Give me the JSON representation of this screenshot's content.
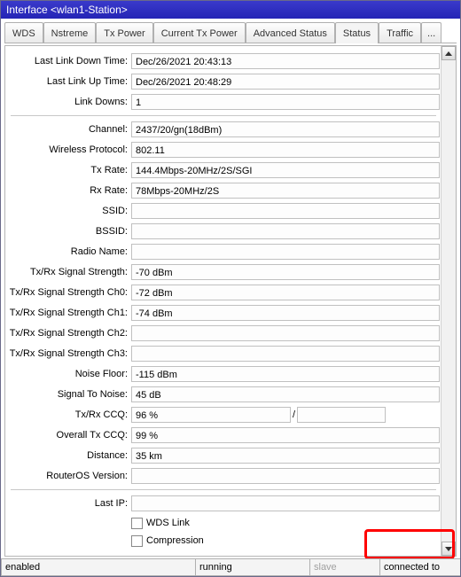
{
  "window": {
    "title": "Interface <wlan1-Station>"
  },
  "tabs": {
    "items": [
      "WDS",
      "Nstreme",
      "Tx Power",
      "Current Tx Power",
      "Advanced Status",
      "Status",
      "Traffic"
    ],
    "more": "...",
    "active_index": 5
  },
  "form": {
    "last_link_down_time": {
      "label": "Last Link Down Time:",
      "value": "Dec/26/2021 20:43:13"
    },
    "last_link_up_time": {
      "label": "Last Link Up Time:",
      "value": "Dec/26/2021 20:48:29"
    },
    "link_downs": {
      "label": "Link Downs:",
      "value": "1"
    },
    "channel": {
      "label": "Channel:",
      "value": "2437/20/gn(18dBm)"
    },
    "wireless_protocol": {
      "label": "Wireless Protocol:",
      "value": "802.11"
    },
    "tx_rate": {
      "label": "Tx Rate:",
      "value": "144.4Mbps-20MHz/2S/SGI"
    },
    "rx_rate": {
      "label": "Rx Rate:",
      "value": "78Mbps-20MHz/2S"
    },
    "ssid": {
      "label": "SSID:",
      "value": ""
    },
    "bssid": {
      "label": "BSSID:",
      "value": ""
    },
    "radio_name": {
      "label": "Radio Name:",
      "value": ""
    },
    "txrx_signal": {
      "label": "Tx/Rx Signal Strength:",
      "value": "-70 dBm"
    },
    "txrx_signal_ch0": {
      "label": "Tx/Rx Signal Strength Ch0:",
      "value": "-72 dBm"
    },
    "txrx_signal_ch1": {
      "label": "Tx/Rx Signal Strength Ch1:",
      "value": "-74 dBm"
    },
    "txrx_signal_ch2": {
      "label": "Tx/Rx Signal Strength Ch2:",
      "value": ""
    },
    "txrx_signal_ch3": {
      "label": "Tx/Rx Signal Strength Ch3:",
      "value": ""
    },
    "noise_floor": {
      "label": "Noise Floor:",
      "value": "-115 dBm"
    },
    "signal_to_noise": {
      "label": "Signal To Noise:",
      "value": "45 dB"
    },
    "txrx_ccq": {
      "label": "Tx/Rx CCQ:",
      "value_a": "96 %",
      "sep": "/",
      "value_b": ""
    },
    "overall_tx_ccq": {
      "label": "Overall Tx CCQ:",
      "value": "99 %"
    },
    "distance": {
      "label": "Distance:",
      "value": "35 km"
    },
    "routeros_version": {
      "label": "RouterOS Version:",
      "value": ""
    },
    "last_ip": {
      "label": "Last IP:",
      "value": ""
    },
    "wds_link": {
      "label": "WDS Link"
    },
    "compression": {
      "label": "Compression"
    }
  },
  "status_bar": {
    "c1": "enabled",
    "c2": "running",
    "c3": "slave",
    "c4": "connected to ess"
  }
}
